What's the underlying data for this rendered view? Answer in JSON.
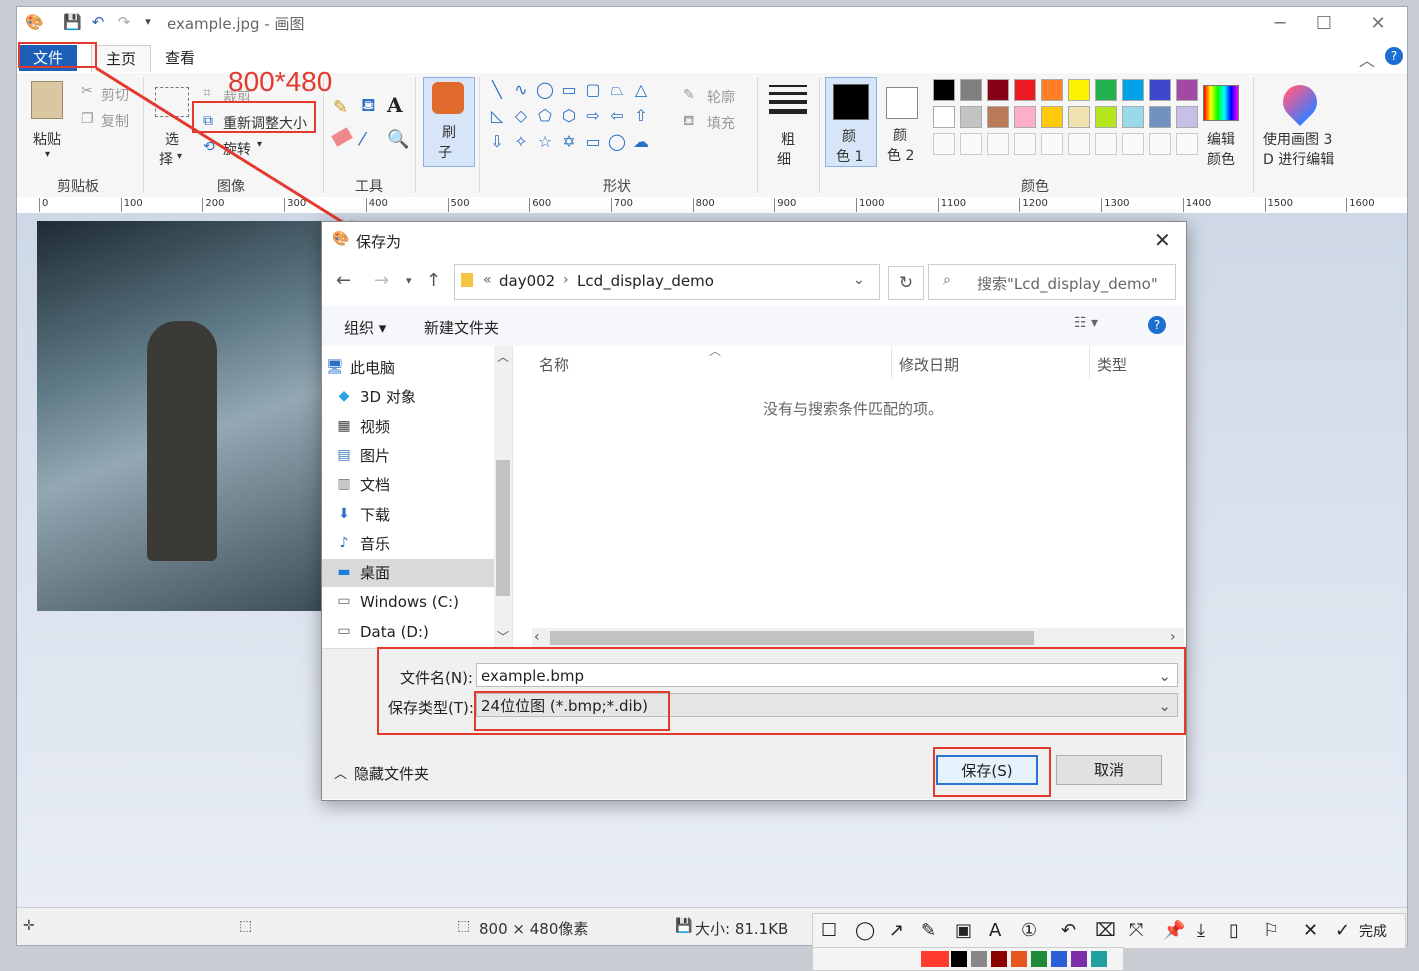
{
  "window": {
    "title": "example.jpg - 画图"
  },
  "tabs": [
    {
      "label": "文件"
    },
    {
      "label": "主页"
    },
    {
      "label": "查看"
    }
  ],
  "ribbon": {
    "clipboard": {
      "paste": "粘贴",
      "cut": "剪切",
      "copy": "复制",
      "group": "剪贴板"
    },
    "image": {
      "select_1": "选",
      "select_2": "择",
      "crop": "裁剪",
      "resize": "重新调整大小",
      "rotate": "旋转",
      "group": "图像"
    },
    "tools": {
      "group": "工具"
    },
    "brush": {
      "l1": "刷",
      "l2": "子"
    },
    "shapes": {
      "outline": "轮廓",
      "fill": "填充",
      "group": "形状"
    },
    "size": {
      "l1": "粗",
      "l2": "细"
    },
    "color1": {
      "l1": "颜",
      "l2": "色 1"
    },
    "color2": {
      "l1": "颜",
      "l2": "色 2"
    },
    "colors": {
      "group": "颜色",
      "row1": [
        "#000000",
        "#7f7f7f",
        "#880015",
        "#ed1c24",
        "#ff7f27",
        "#fff200",
        "#22b14c",
        "#00a2e8",
        "#3f48cc",
        "#a349a4"
      ],
      "row2": [
        "#ffffff",
        "#c3c3c3",
        "#b97a57",
        "#ffaec9",
        "#ffc90e",
        "#efe4b0",
        "#b5e61d",
        "#99d9ea",
        "#7092be",
        "#c8bfe7"
      ]
    },
    "edit_colors": {
      "l1": "编辑",
      "l2": "颜色"
    },
    "paint3d": {
      "l1": "使用画图 3",
      "l2": "D 进行编辑"
    }
  },
  "annotation_text": "800*480",
  "ruler_ticks": [
    "0",
    "100",
    "200",
    "300",
    "400",
    "500",
    "600",
    "700",
    "800",
    "900",
    "1000",
    "1100",
    "1200",
    "1300",
    "1400",
    "1500",
    "1600"
  ],
  "status": {
    "dimensions": "800 × 480像素",
    "size": "大小: 81.1KB"
  },
  "dialog": {
    "title": "保存为",
    "breadcrumb": [
      "«",
      "day002",
      "›",
      "Lcd_display_demo"
    ],
    "search_placeholder": "搜索\"Lcd_display_demo\"",
    "organize": "组织 ▾",
    "new_folder": "新建文件夹",
    "nav_items": [
      {
        "label": "此电脑",
        "icon": "computer-icon"
      },
      {
        "label": "3D 对象",
        "icon": "cube-icon"
      },
      {
        "label": "视频",
        "icon": "video-icon"
      },
      {
        "label": "图片",
        "icon": "picture-icon"
      },
      {
        "label": "文档",
        "icon": "document-icon"
      },
      {
        "label": "下载",
        "icon": "download-icon"
      },
      {
        "label": "音乐",
        "icon": "music-icon"
      },
      {
        "label": "桌面",
        "icon": "desktop-icon"
      },
      {
        "label": "Windows (C:)",
        "icon": "drive-icon"
      },
      {
        "label": "Data (D:)",
        "icon": "drive-icon"
      }
    ],
    "columns": {
      "name": "名称",
      "date": "修改日期",
      "type": "类型"
    },
    "empty_message": "没有与搜索条件匹配的项。",
    "filename_label": "文件名(N):",
    "filename_value": "example.bmp",
    "filetype_label": "保存类型(T):",
    "filetype_value": "24位位图 (*.bmp;*.dib)",
    "hide_folders": "隐藏文件夹",
    "save": "保存(S)",
    "cancel": "取消"
  },
  "snip_toolbar": {
    "done": "完成",
    "palette": [
      "#ff3b2f",
      "#000000",
      "#888888",
      "#8b0000",
      "#e8551e",
      "#1e8a3a",
      "#2a5fd8",
      "#7a2fa8",
      "#1ea0a0"
    ]
  }
}
